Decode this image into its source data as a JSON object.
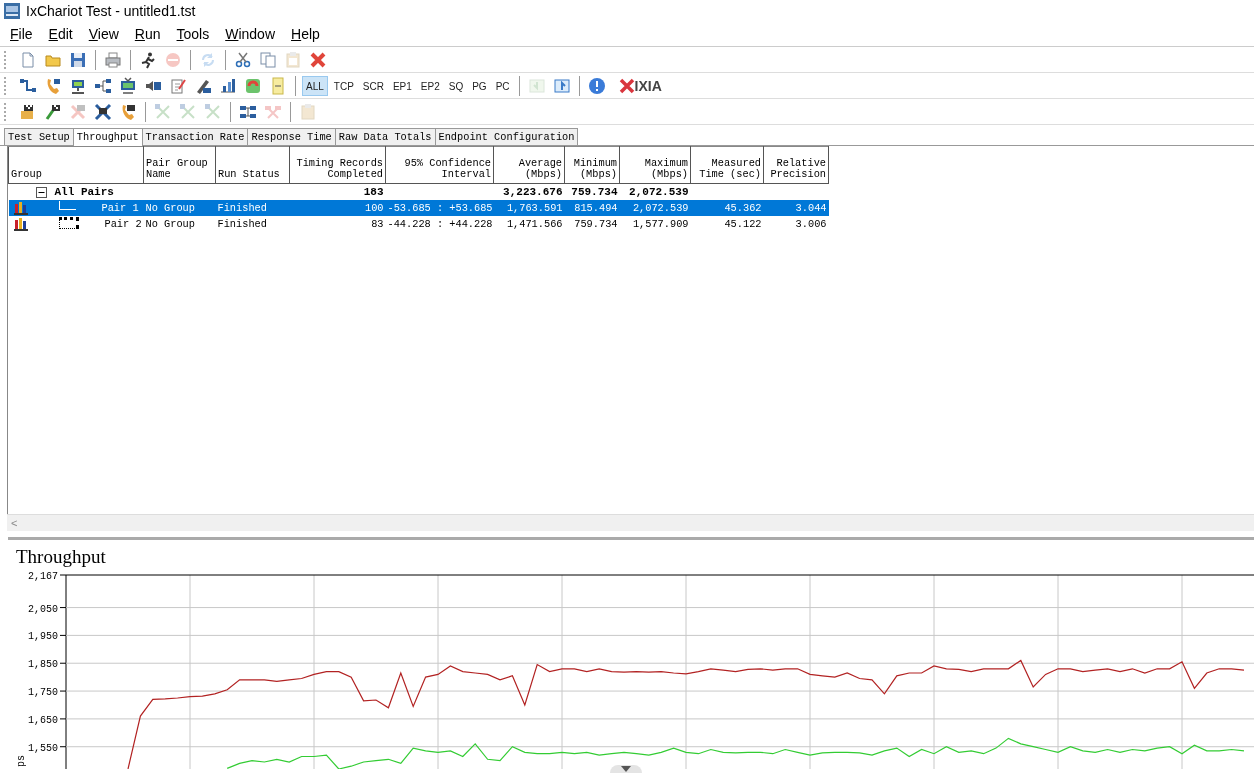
{
  "window": {
    "title": "IxChariot Test - untitled1.tst"
  },
  "menu": [
    {
      "label": "File"
    },
    {
      "label": "Edit"
    },
    {
      "label": "View"
    },
    {
      "label": "Run"
    },
    {
      "label": "Tools"
    },
    {
      "label": "Window"
    },
    {
      "label": "Help"
    }
  ],
  "toolbars": [
    {
      "items": [
        {
          "kind": "icon",
          "disabled": false
        },
        {
          "kind": "icon",
          "disabled": false
        },
        {
          "kind": "icon",
          "disabled": false
        },
        {
          "kind": "separator"
        },
        {
          "kind": "icon",
          "disabled": false
        },
        {
          "kind": "separator"
        },
        {
          "kind": "icon",
          "disabled": false
        },
        {
          "kind": "icon",
          "disabled": true
        },
        {
          "kind": "separator"
        },
        {
          "kind": "icon",
          "disabled": true
        },
        {
          "kind": "separator"
        },
        {
          "kind": "icon",
          "disabled": false
        },
        {
          "kind": "icon",
          "disabled": false
        },
        {
          "kind": "icon",
          "disabled": true
        },
        {
          "kind": "icon",
          "disabled": false
        }
      ]
    },
    {
      "items": [
        {
          "kind": "icon",
          "disabled": false
        },
        {
          "kind": "icon",
          "disabled": false
        },
        {
          "kind": "icon",
          "disabled": false
        },
        {
          "kind": "icon",
          "disabled": false
        },
        {
          "kind": "icon",
          "disabled": false
        },
        {
          "kind": "icon",
          "disabled": false
        },
        {
          "kind": "icon",
          "disabled": false
        },
        {
          "kind": "icon",
          "disabled": false
        },
        {
          "kind": "icon",
          "disabled": false
        },
        {
          "kind": "icon",
          "disabled": false
        },
        {
          "kind": "icon",
          "disabled": false
        },
        {
          "kind": "separator"
        },
        {
          "kind": "text",
          "label": "ALL",
          "selected": true
        },
        {
          "kind": "text",
          "label": "TCP",
          "selected": false
        },
        {
          "kind": "text",
          "label": "SCR",
          "selected": false
        },
        {
          "kind": "text",
          "label": "EP1",
          "selected": false
        },
        {
          "kind": "text",
          "label": "EP2",
          "selected": false
        },
        {
          "kind": "text",
          "label": "SQ",
          "selected": false
        },
        {
          "kind": "text",
          "label": "PG",
          "selected": false
        },
        {
          "kind": "text",
          "label": "PC",
          "selected": false
        },
        {
          "kind": "separator"
        },
        {
          "kind": "icon",
          "disabled": true
        },
        {
          "kind": "icon",
          "disabled": false
        },
        {
          "kind": "separator"
        },
        {
          "kind": "icon",
          "disabled": false
        },
        {
          "kind": "logo",
          "label": "IXIA"
        }
      ]
    },
    {
      "items": [
        {
          "kind": "icon",
          "disabled": false
        },
        {
          "kind": "icon",
          "disabled": false
        },
        {
          "kind": "icon",
          "disabled": true
        },
        {
          "kind": "icon",
          "disabled": false
        },
        {
          "kind": "icon",
          "disabled": false
        },
        {
          "kind": "separator"
        },
        {
          "kind": "icon",
          "disabled": true
        },
        {
          "kind": "icon",
          "disabled": true
        },
        {
          "kind": "icon",
          "disabled": true
        },
        {
          "kind": "separator"
        },
        {
          "kind": "icon",
          "disabled": false
        },
        {
          "kind": "icon",
          "disabled": true
        },
        {
          "kind": "separator"
        },
        {
          "kind": "icon",
          "disabled": true
        }
      ]
    }
  ],
  "tabs": [
    {
      "label": "Test Setup",
      "selected": false
    },
    {
      "label": "Throughput",
      "selected": true
    },
    {
      "label": "Transaction Rate",
      "selected": false
    },
    {
      "label": "Response Time",
      "selected": false
    },
    {
      "label": "Raw Data Totals",
      "selected": false
    },
    {
      "label": "Endpoint Configuration",
      "selected": false
    }
  ],
  "table": {
    "columns": [
      "Group",
      "Pair Group\nName",
      "Run Status",
      "Timing Records\nCompleted",
      "95% Confidence\nInterval",
      "Average\n(Mbps)",
      "Minimum\n(Mbps)",
      "Maximum\n(Mbps)",
      "Measured\nTime (sec)",
      "Relative\nPrecision"
    ],
    "group_row": {
      "expanded": true,
      "cells": [
        "All Pairs",
        "",
        "",
        "183",
        "",
        "3,223.676",
        "759.734",
        "2,072.539",
        "",
        ""
      ]
    },
    "rows": [
      {
        "selected": true,
        "cells": [
          "Pair 1",
          "No Group",
          "Finished",
          "100",
          "-53.685 : +53.685",
          "1,763.591",
          "815.494",
          "2,072.539",
          "45.362",
          "3.044"
        ]
      },
      {
        "selected": false,
        "cells": [
          "Pair 2",
          "No Group",
          "Finished",
          "83",
          "-44.228 : +44.228",
          "1,471.566",
          "759.734",
          "1,577.909",
          "45.122",
          "3.006"
        ]
      }
    ]
  },
  "scrollbar": {
    "left_arrow": "<"
  },
  "chart_panel": {
    "title": "Throughput",
    "chart_data": {
      "type": "line",
      "grid": true,
      "ylabel": "ps",
      "ylim": [
        1470,
        2167
      ],
      "yticks": [
        {
          "value": 2167,
          "label": "2,167"
        },
        {
          "value": 2050,
          "label": "2,050"
        },
        {
          "value": 1950,
          "label": "1,950"
        },
        {
          "value": 1850,
          "label": "1,850"
        },
        {
          "value": 1750,
          "label": "1,750"
        },
        {
          "value": 1650,
          "label": "1,650"
        },
        {
          "value": 1550,
          "label": "1,550"
        }
      ],
      "series": [
        {
          "color": "#b22222",
          "values": [
            null,
            null,
            null,
            null,
            null,
            1470,
            1660,
            1720,
            1722,
            1725,
            1730,
            1732,
            1740,
            1755,
            1790,
            1790,
            1790,
            1785,
            1790,
            1795,
            1810,
            1820,
            1820,
            1800,
            1715,
            1718,
            1690,
            1815,
            1695,
            1800,
            1810,
            1840,
            1820,
            1815,
            1810,
            1790,
            1805,
            1700,
            1845,
            1820,
            1830,
            1830,
            1820,
            1830,
            1820,
            1818,
            1820,
            1818,
            1820,
            1815,
            1812,
            1820,
            1830,
            1825,
            1820,
            1828,
            1830,
            1825,
            1830,
            1830,
            1810,
            1805,
            1800,
            1815,
            1795,
            1790,
            1740,
            1805,
            1815,
            1815,
            1840,
            1830,
            1828,
            1820,
            1830,
            1830,
            1830,
            1860,
            1765,
            1810,
            1830,
            1830,
            1820,
            1825,
            1830,
            1820,
            1830,
            1815,
            1830,
            1830,
            1855,
            1760,
            1815,
            1830,
            1830,
            1825
          ]
        },
        {
          "color": "#33cc33",
          "values": [
            null,
            null,
            null,
            null,
            null,
            null,
            null,
            null,
            null,
            null,
            null,
            null,
            null,
            1472,
            1490,
            1500,
            1495,
            1505,
            1495,
            1515,
            1515,
            1520,
            1470,
            1480,
            1495,
            1500,
            1505,
            1490,
            1545,
            1535,
            1530,
            1535,
            1515,
            1560,
            1505,
            1500,
            1550,
            1530,
            1525,
            1525,
            1530,
            1525,
            1530,
            1520,
            1525,
            1530,
            1525,
            1520,
            1530,
            1545,
            1530,
            1525,
            1540,
            1530,
            1528,
            1530,
            1530,
            1525,
            1540,
            1530,
            1520,
            1528,
            1530,
            1530,
            1528,
            1520,
            1535,
            1545,
            1515,
            1540,
            1525,
            1550,
            1530,
            1535,
            1525,
            1545,
            1580,
            1560,
            1550,
            1540,
            1530,
            1550,
            1535,
            1530,
            1540,
            1530,
            1540,
            1535,
            1545,
            1550,
            1525,
            1555,
            1535,
            1535,
            1540,
            1535
          ]
        }
      ]
    }
  }
}
